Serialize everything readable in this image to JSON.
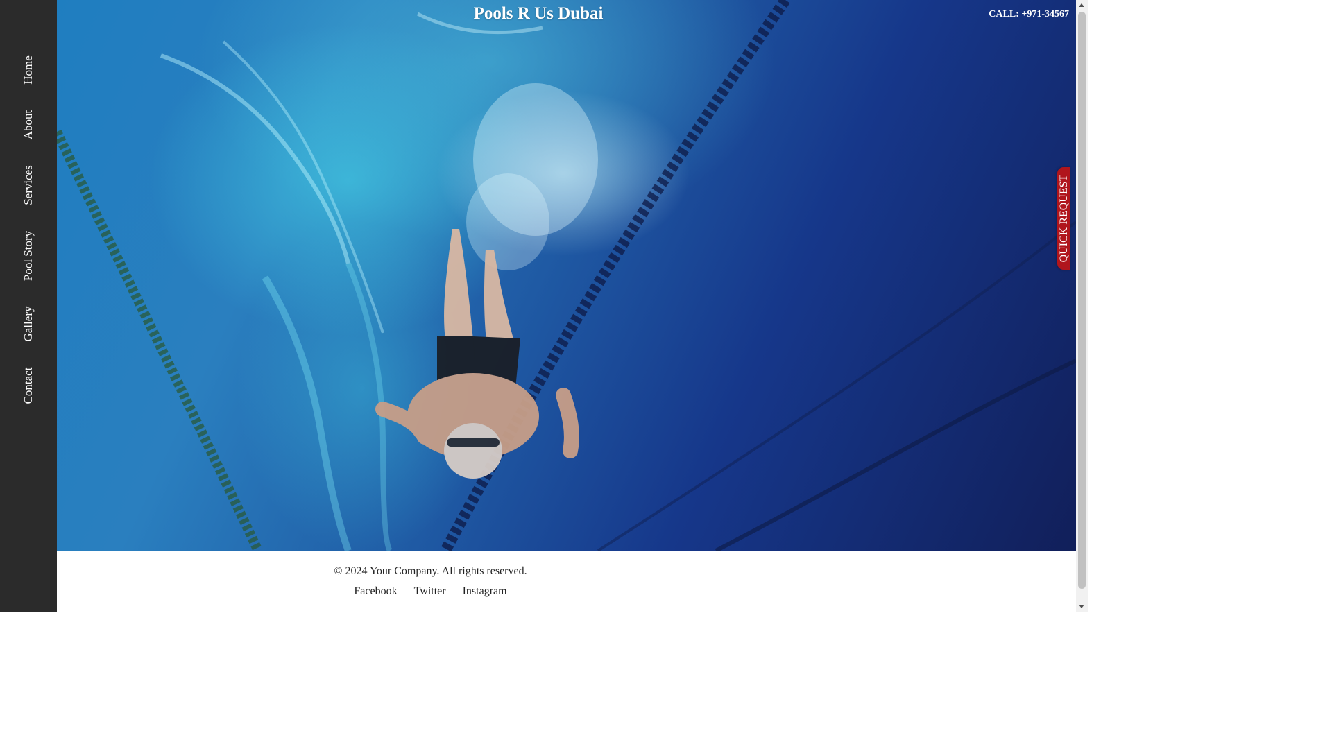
{
  "sidebar": {
    "items": [
      {
        "label": "Home"
      },
      {
        "label": "About"
      },
      {
        "label": "Services"
      },
      {
        "label": "Pool Story"
      },
      {
        "label": "Gallery"
      },
      {
        "label": "Contact"
      }
    ]
  },
  "header": {
    "title": "Pools R Us Dubai",
    "call": "CALL: +971-34567"
  },
  "quick_request": {
    "label": "QUICK REQUEST"
  },
  "hero": {
    "image": "underwater-swimmer-photo"
  },
  "footer": {
    "copyright": "© 2024 Your Company. All rights reserved.",
    "links": [
      {
        "label": "Facebook"
      },
      {
        "label": "Twitter"
      },
      {
        "label": "Instagram"
      }
    ]
  },
  "colors": {
    "sidebar_bg": "#2b2b2b",
    "accent_red": "#b0151c",
    "water_blue": "#1f5aa4"
  }
}
